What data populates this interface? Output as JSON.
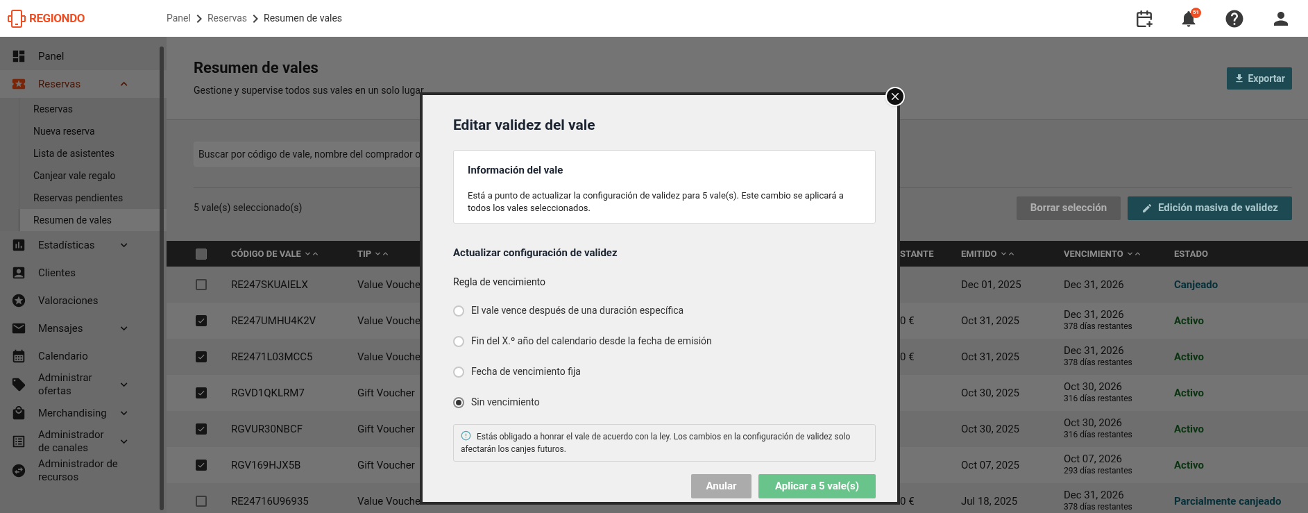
{
  "header": {
    "logo": "REGIONDO",
    "breadcrumb": [
      "Panel",
      "Reservas",
      "Resumen de vales"
    ],
    "notifications": "51"
  },
  "sidebar": {
    "items": [
      {
        "label": "Panel",
        "selected": false
      },
      {
        "label": "Reservas",
        "selected": true,
        "expanded": true,
        "children": [
          {
            "label": "Reservas",
            "selected": false
          },
          {
            "label": "Nueva reserva",
            "selected": false
          },
          {
            "label": "Lista de asistentes",
            "selected": false
          },
          {
            "label": "Canjear vale regalo",
            "selected": false
          },
          {
            "label": "Reservas pendientes",
            "selected": false
          },
          {
            "label": "Resumen de vales",
            "selected": true
          }
        ]
      },
      {
        "label": "Estadísticas",
        "selected": false,
        "expanded": false
      },
      {
        "label": "Clientes",
        "selected": false
      },
      {
        "label": "Valoraciones",
        "selected": false
      },
      {
        "label": "Mensajes",
        "selected": false,
        "expanded": false
      },
      {
        "label": "Calendario",
        "selected": false
      },
      {
        "label": "Administrar ofertas",
        "selected": false,
        "expanded": false
      },
      {
        "label": "Merchandising",
        "selected": false,
        "expanded": false
      },
      {
        "label": "Administrador de canales",
        "selected": false,
        "expanded": false
      },
      {
        "label": "Administrador de recursos",
        "selected": false
      }
    ]
  },
  "page": {
    "title": "Resumen de vales",
    "subtitle": "Gestione y supervise todos sus vales en un solo lugar",
    "export": "Exportar",
    "search": {
      "placeholder": "Buscar por código de vale, nombre del comprador o"
    },
    "selection": "5 vale(s) seleccionado(s)",
    "clear": "Borrar selección",
    "bulk_edit": "Edición masiva de validez"
  },
  "table": {
    "select_all": {
      "checked": false
    },
    "columns": [
      {
        "label": "CÓDIGO DE VALE",
        "sortable": true
      },
      {
        "label": "TIP",
        "sortable": true
      },
      {
        "label": "STANTE",
        "sortable": false
      },
      {
        "label": "EMITIDO",
        "sortable": true
      },
      {
        "label": "VENCIMIENTO",
        "sortable": true
      },
      {
        "label": "ESTADO",
        "sortable": false
      }
    ],
    "rows": [
      {
        "checked": false,
        "code": "RE247SKUAIELX",
        "type": "Value Vouche",
        "remaining": "",
        "issued": "Dec 01, 2025",
        "expires": "Dec 31, 2026",
        "days_left": "",
        "status": "Canjeado",
        "kind": "redeemed"
      },
      {
        "checked": true,
        "code": "RE247UMHU4K2V",
        "type": "Value Vouche",
        "remaining": "0 €",
        "issued": "Oct 31, 2025",
        "expires": "Dec 31, 2026",
        "days_left": "378 días restantes",
        "status": "Activo",
        "kind": "active"
      },
      {
        "checked": true,
        "code": "RE2471L03MCC5",
        "type": "Value Vouche",
        "remaining": "0 €",
        "issued": "Oct 31, 2025",
        "expires": "Dec 31, 2026",
        "days_left": "378 días restantes",
        "status": "Activo",
        "kind": "active"
      },
      {
        "checked": true,
        "code": "RGVD1QKLRM7",
        "type": "Gift Voucher",
        "remaining": "",
        "issued": "Oct 30, 2025",
        "expires": "Oct 30, 2026",
        "days_left": "316 días restantes",
        "status": "Activo",
        "kind": "active"
      },
      {
        "checked": true,
        "code": "RGVUR30NBCF",
        "type": "Gift Voucher",
        "remaining": "",
        "issued": "Oct 30, 2025",
        "expires": "Oct 30, 2026",
        "days_left": "316 días restantes",
        "status": "Activo",
        "kind": "active"
      },
      {
        "checked": true,
        "code": "RGV169HJX5B",
        "type": "Gift Voucher",
        "remaining": "",
        "issued": "Oct 07, 2025",
        "expires": "Oct 07, 2026",
        "days_left": "293 días restantes",
        "status": "Activo",
        "kind": "active"
      },
      {
        "checked": false,
        "code": "RE24716U96935",
        "type": "Value Vouche",
        "remaining": "0 €",
        "issued": "Jul 18, 2025",
        "expires": "Dec 31, 2026",
        "days_left": "378 días restantes",
        "status": "Parcialmente canjeado",
        "kind": "partial"
      }
    ]
  },
  "modal": {
    "title": "Editar validez del vale",
    "info": {
      "title": "Información del vale",
      "text": "Está a punto de actualizar la configuración de validez para 5 vale(s). Este cambio se aplicará a todos los vales seleccionados."
    },
    "section": "Actualizar configuración de validez",
    "field_label": "Regla de vencimiento",
    "options": [
      {
        "label": "El vale vence después de una duración específica",
        "selected": false
      },
      {
        "label": "Fin del X.º año del calendario desde la fecha de emisión",
        "selected": false
      },
      {
        "label": "Fecha de vencimiento fija",
        "selected": false
      },
      {
        "label": "Sin vencimiento",
        "selected": true
      }
    ],
    "notice": "Estás obligado a honrar el vale de acuerdo con la ley. Los cambios en la configuración de validez solo afectarán los canjes futuros.",
    "cancel": "Anular",
    "apply": "Aplicar a 5 vale(s)"
  }
}
